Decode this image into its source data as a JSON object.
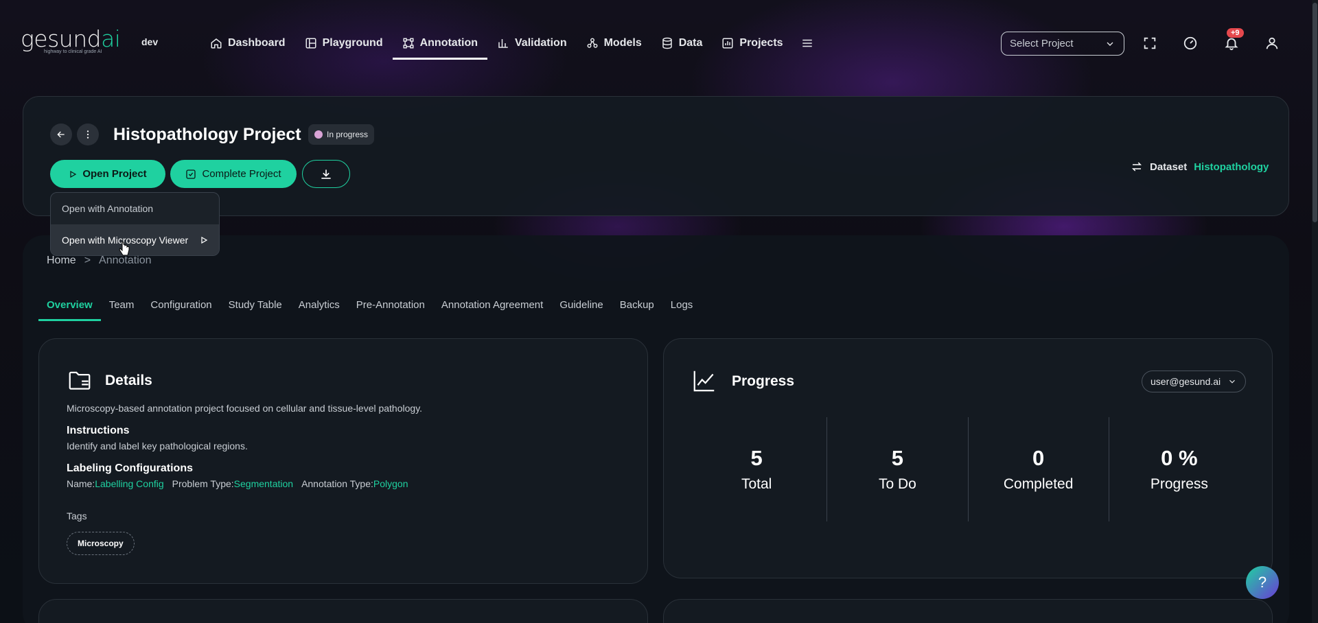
{
  "brand": {
    "logo_main": "gesund",
    "logo_ai": "ai",
    "tagline": "highway to clinical grade AI",
    "env": "dev"
  },
  "nav": {
    "items": [
      {
        "label": "Dashboard",
        "icon": "home-icon"
      },
      {
        "label": "Playground",
        "icon": "playground-icon"
      },
      {
        "label": "Annotation",
        "icon": "annotation-icon",
        "active": true
      },
      {
        "label": "Validation",
        "icon": "bar-chart-icon"
      },
      {
        "label": "Models",
        "icon": "models-icon"
      },
      {
        "label": "Data",
        "icon": "database-icon"
      },
      {
        "label": "Projects",
        "icon": "projects-icon"
      }
    ],
    "select_project_placeholder": "Select Project",
    "notifications_count": "+9"
  },
  "project": {
    "title": "Histopathology Project",
    "status": "In progress",
    "open_label": "Open Project",
    "complete_label": "Complete Project",
    "dataset_label": "Dataset",
    "dataset_value": "Histopathology"
  },
  "open_menu": {
    "items": [
      "Open with Annotation",
      "Open with Microscopy Viewer"
    ]
  },
  "breadcrumb": {
    "home": "Home",
    "sep": ">",
    "current": "Annotation"
  },
  "tabs": [
    "Overview",
    "Team",
    "Configuration",
    "Study Table",
    "Analytics",
    "Pre-Annotation",
    "Annotation Agreement",
    "Guideline",
    "Backup",
    "Logs"
  ],
  "details": {
    "title": "Details",
    "description": "Microscopy-based annotation project focused on cellular and tissue-level pathology.",
    "instructions_head": "Instructions",
    "instructions_text": "Identify and label key pathological regions.",
    "labeling_head": "Labeling Configurations",
    "name_label": "Name:",
    "name_value": "Labelling Config",
    "problem_label": "Problem Type:",
    "problem_value": "Segmentation",
    "annotation_label": "Annotation Type:",
    "annotation_value": "Polygon",
    "tags_label": "Tags",
    "tags": [
      "Microscopy"
    ]
  },
  "progress": {
    "title": "Progress",
    "user": "user@gesund.ai",
    "stats": [
      {
        "value": "5",
        "label": "Total"
      },
      {
        "value": "5",
        "label": "To Do"
      },
      {
        "value": "0",
        "label": "Completed"
      },
      {
        "value": "0 %",
        "label": "Progress"
      }
    ]
  },
  "help": "?"
}
